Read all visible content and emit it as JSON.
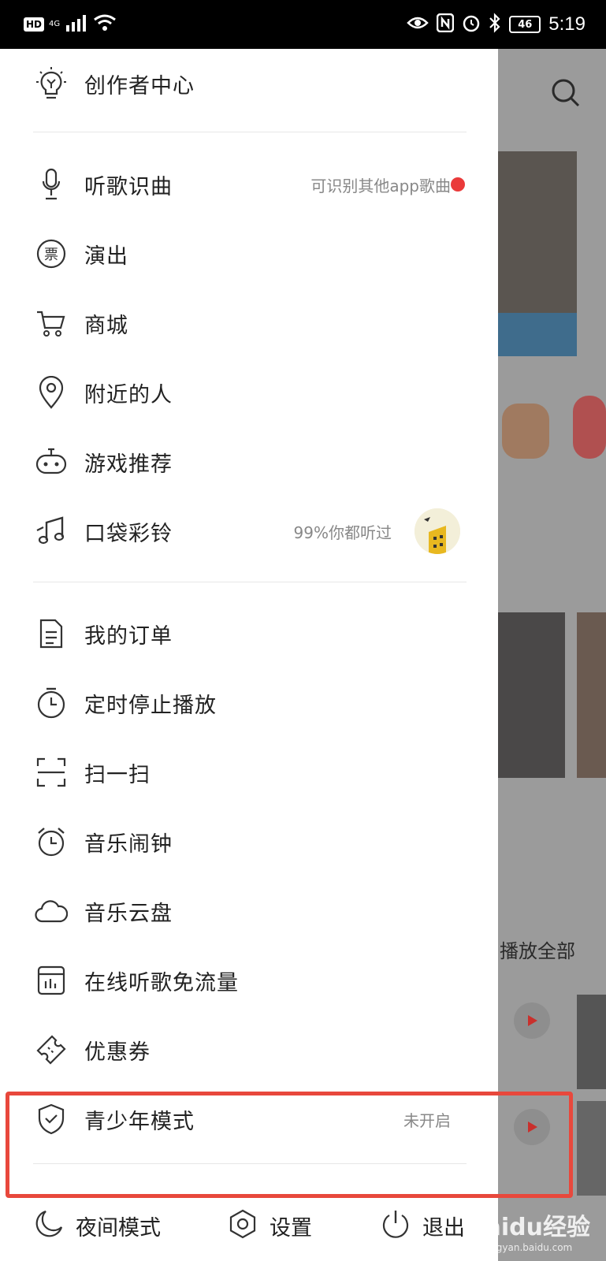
{
  "status_bar": {
    "hd": "HD",
    "net": "4G",
    "battery": "46",
    "time": "5:19"
  },
  "background_app": {
    "partial_text": "播放全部"
  },
  "drawer": {
    "creator_center": "创作者中心",
    "items": [
      {
        "label": "听歌识曲",
        "sub": "可识别其他app歌曲"
      },
      {
        "label": "演出",
        "icon_text": "票"
      },
      {
        "label": "商城"
      },
      {
        "label": "附近的人"
      },
      {
        "label": "游戏推荐"
      },
      {
        "label": "口袋彩铃",
        "sub": "99%你都听过"
      },
      {
        "label": "我的订单"
      },
      {
        "label": "定时停止播放"
      },
      {
        "label": "扫一扫"
      },
      {
        "label": "音乐闹钟"
      },
      {
        "label": "音乐云盘"
      },
      {
        "label": "在线听歌免流量"
      },
      {
        "label": "优惠券"
      },
      {
        "label": "青少年模式",
        "sub": "未开启"
      }
    ],
    "bottom": {
      "night_mode": "夜间模式",
      "settings": "设置",
      "logout": "退出"
    }
  },
  "watermark": {
    "brand": "Baidu经验",
    "url": "jingyan.baidu.com"
  },
  "colors": {
    "accent_red": "#e8483c",
    "dot_red": "#ea3a3a",
    "text": "#222222",
    "subtext": "#888888"
  }
}
